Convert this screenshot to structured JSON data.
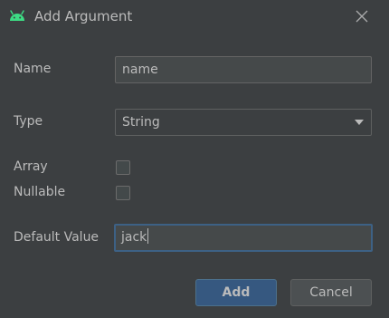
{
  "dialog": {
    "title": "Add Argument"
  },
  "form": {
    "name_label": "Name",
    "name_value": "name",
    "type_label": "Type",
    "type_value": "String",
    "array_label": "Array",
    "array_checked": false,
    "nullable_label": "Nullable",
    "nullable_checked": false,
    "default_label": "Default Value",
    "default_value": "jack"
  },
  "buttons": {
    "add_label": "Add",
    "cancel_label": "Cancel"
  },
  "colors": {
    "background": "#3c3f41",
    "text": "#bbbbbb",
    "android_green": "#3ddc84",
    "primary_button": "#365880",
    "focus_border": "#3d6185"
  },
  "icons": {
    "app": "android-icon",
    "close": "close-icon",
    "dropdown": "chevron-down-icon"
  }
}
